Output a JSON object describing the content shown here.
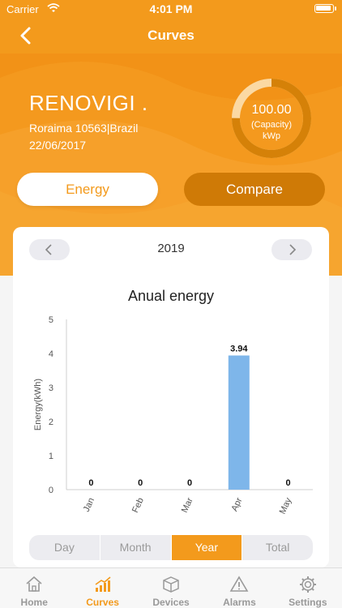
{
  "status_bar": {
    "carrier": "Carrier",
    "time": "4:01 PM"
  },
  "nav": {
    "title": "Curves",
    "back_icon": "chevron-left-icon"
  },
  "plant": {
    "name": "RENOVIGI .",
    "address": "Roraima 10563|Brazil",
    "date": "22/06/2017",
    "capacity_value": "100.00",
    "capacity_label": "(Capacity)",
    "capacity_unit": "kWp",
    "capacity_fraction": 0.75
  },
  "buttons": {
    "energy": "Energy",
    "compare": "Compare"
  },
  "year_selector": {
    "year": "2019"
  },
  "chart_data": {
    "type": "bar",
    "title": "Anual energy",
    "ylabel": "Energy(kWh)",
    "xlabel": "",
    "categories": [
      "Jan",
      "Feb",
      "Mar",
      "Apr",
      "May"
    ],
    "values": [
      0,
      0,
      0,
      3.94,
      0
    ],
    "value_labels": [
      "0",
      "0",
      "0",
      "3.94",
      "0"
    ],
    "ylim": [
      0,
      5
    ],
    "yticks": [
      "0",
      "1",
      "2",
      "3",
      "4",
      "5"
    ],
    "bar_color": "#7eb6ea",
    "grid": false
  },
  "period_tabs": [
    {
      "label": "Day",
      "active": false
    },
    {
      "label": "Month",
      "active": false
    },
    {
      "label": "Year",
      "active": true
    },
    {
      "label": "Total",
      "active": false
    }
  ],
  "tab_bar": [
    {
      "label": "Home",
      "icon": "home-icon",
      "active": false
    },
    {
      "label": "Curves",
      "icon": "chart-icon",
      "active": true
    },
    {
      "label": "Devices",
      "icon": "box-icon",
      "active": false
    },
    {
      "label": "Alarms",
      "icon": "warning-icon",
      "active": false
    },
    {
      "label": "Settings",
      "icon": "gear-icon",
      "active": false
    }
  ],
  "colors": {
    "accent": "#f39a1c",
    "compare": "#cf7a06",
    "bar": "#7eb6ea"
  }
}
